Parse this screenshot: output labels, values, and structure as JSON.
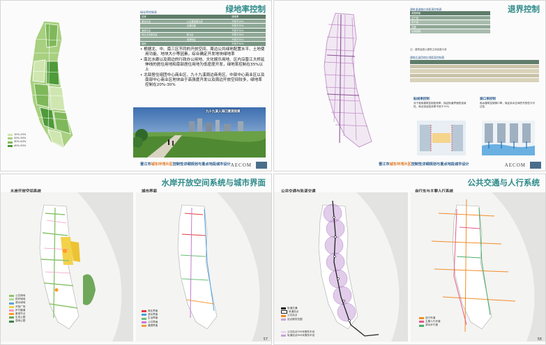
{
  "footer": {
    "prefix": "晋江市",
    "highlight": "城东环湾片区",
    "rest": "控制性详细规划与重点地段城市设计"
  },
  "brand": "AECOM",
  "p1": {
    "title": "绿地率控制",
    "table_caption": "绿化率控制表",
    "table_header": [
      "区域",
      "",
      "绿地率"
    ],
    "table_rows": [
      [
        "城北片区",
        "以主要道路为线",
        "不低于20%"
      ],
      [
        "",
        "沿湖沿路",
        "不低于35%"
      ],
      [
        "南部片区",
        "",
        "不低于30%"
      ],
      [
        "商业文化服务区",
        "核心区",
        "不低于20%"
      ],
      [
        "",
        "滨湖地区",
        "不低于35%"
      ],
      [
        "其他",
        "",
        "不低于30%"
      ]
    ],
    "bullets": [
      "根据北、中、南三区不同的开放空间、周边公共绿地配置水平、土地使用功能、地块大小等因素，综合确定开发地块绿地率",
      "南北水廊以及周边的行政办公用地、文化娱乐用地、区内沿晋江大桥延伸线的居住用地和南部居住用地为低密度开发，绿地率控制在35%以上",
      "北部居住组团中心商业区、九十九溪周边商务区、中部中心商业区以及南部中心商业区地块由于高强度开发以及周边开放空间较多，绿地率控制在20%-30%"
    ],
    "photo_caption": "九十九溪入海口景观效果",
    "legend": [
      "10%-20%",
      "20%-30%",
      "30%-40%",
      "40%-50%"
    ]
  },
  "p2": {
    "title": "退界控制",
    "table1_caption": "建筑退道路红线距离控制表",
    "table1_header": [
      "道路等级",
      "",
      "",
      "",
      ""
    ],
    "table1_rows": [
      [
        "主干道",
        "",
        "",
        "",
        ""
      ],
      [
        "次干道",
        "",
        "",
        "",
        ""
      ],
      [
        "支路",
        "",
        "",
        "",
        ""
      ],
      [
        "沿湖道路",
        "",
        "",
        "",
        ""
      ]
    ],
    "table1_note": "注：建筑高度以建筑主体高度为准",
    "table2_caption": "建筑后退用地红线距离控制表",
    "table2_header": [
      "",
      "",
      "",
      "",
      "",
      ""
    ],
    "table2_rows": [
      [
        "",
        "",
        "",
        "",
        "",
        ""
      ],
      [
        "",
        "",
        "",
        "",
        "",
        ""
      ],
      [
        "",
        "",
        "",
        "",
        "",
        ""
      ],
      [
        "",
        "",
        "",
        "",
        "",
        ""
      ]
    ],
    "note1_title": "贴线率控制",
    "note1_body": "对于临街建筑控制贴线率，保证街道界面的连续性，商业街区贴线率不低于70%",
    "note2_title": "骑口率控制",
    "note2_body": "临水建筑控制骑口率，保证亲水空间的开放性与可达性"
  },
  "p3": {
    "title": "水岸开放空间系统与城市界面",
    "sub_left": "水岸开放空间系统",
    "sub_right": "城市界面",
    "legend_left": [
      "公共绿地",
      "防护绿地",
      "滨水绿地",
      "开放广场",
      "步行廊道",
      "景观节点",
      "生态公园",
      "湿地公园"
    ],
    "legend_right": [
      "商业界面",
      "滨水界面",
      "生活界面",
      "公共界面",
      "通透界面"
    ],
    "page_number": "57"
  },
  "p4": {
    "title": "公共交通与人行系统",
    "sub_left": "公共交通与轨道交通",
    "sub_right": "自行车与主要人行系统",
    "legend_left": [
      "轨道交通",
      "轨道站点",
      "公交站点",
      "站点服务范围"
    ],
    "legend_left_bottom": [
      "公交站点500米服务半径",
      "轨道站点800米服务半径"
    ],
    "legend_right": [
      "自行车道",
      "主要人行步道",
      "滨水步行道"
    ],
    "page_number": "58"
  },
  "colors": {
    "title": "#2f8a8a",
    "green1": "#cfe6b0",
    "green2": "#a8d080",
    "green3": "#7fb85a",
    "green4": "#4f9a3a",
    "table_dark": "#5f7d6a",
    "table_mid": "#8fa896",
    "orange": "#f28c28",
    "purple": "#b58cc8"
  }
}
